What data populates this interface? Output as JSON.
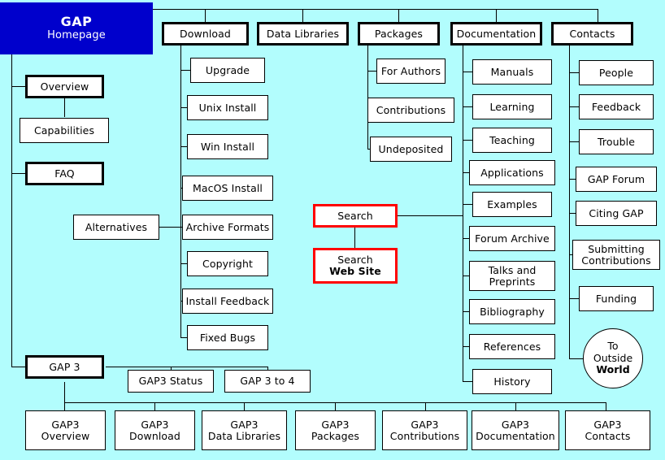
{
  "page": {
    "title": "GAP Homepage Sitemap",
    "background_color": "#b2fdfd",
    "accent_color": "#0000cc",
    "highlight_color": "#ff0000"
  },
  "home": {
    "name": "GAP",
    "subtitle": "Homepage"
  },
  "left_column": {
    "overview": "Overview",
    "capabilities": "Capabilities",
    "faq": "FAQ",
    "gap3": "GAP 3"
  },
  "top_nav": {
    "download": "Download",
    "data_libraries": "Data Libraries",
    "packages": "Packages",
    "documentation": "Documentation",
    "contacts": "Contacts"
  },
  "download_items": [
    "Upgrade",
    "Unix Install",
    "Win Install",
    "MacOS Install",
    "Archive Formats",
    "Copyright",
    "Install Feedback",
    "Fixed Bugs"
  ],
  "alternatives": "Alternatives",
  "packages_items": [
    "For Authors",
    "Contributions",
    "Undeposited"
  ],
  "search": {
    "search": "Search",
    "search_web_line1": "Search",
    "search_web_line2": "Web Site"
  },
  "documentation_items": [
    "Manuals",
    "Learning",
    "Teaching",
    "Applications",
    "Examples",
    "Forum Archive",
    "Talks and\nPreprints",
    "Bibliography",
    "References",
    "History"
  ],
  "documentation_items_multiline": {
    "talks_line1": "Talks and",
    "talks_line2": "Preprints"
  },
  "contacts_items": [
    "People",
    "Feedback",
    "Trouble",
    "GAP Forum",
    "Citing GAP",
    "Submitting\nContributions",
    "Funding"
  ],
  "contacts_items_multiline": {
    "submitting_line1": "Submitting",
    "submitting_line2": "Contributions"
  },
  "outside_world": {
    "line1": "To",
    "line2": "Outside",
    "line3": "World"
  },
  "gap3_siblings": {
    "status": "GAP3 Status",
    "gap3to4": "GAP 3 to 4"
  },
  "gap3_row": [
    {
      "line1": "GAP3",
      "line2": "Overview"
    },
    {
      "line1": "GAP3",
      "line2": "Download"
    },
    {
      "line1": "GAP3",
      "line2": "Data Libraries"
    },
    {
      "line1": "GAP3",
      "line2": "Packages"
    },
    {
      "line1": "GAP3",
      "line2": "Contributions"
    },
    {
      "line1": "GAP3",
      "line2": "Documentation"
    },
    {
      "line1": "GAP3",
      "line2": "Contacts"
    }
  ]
}
